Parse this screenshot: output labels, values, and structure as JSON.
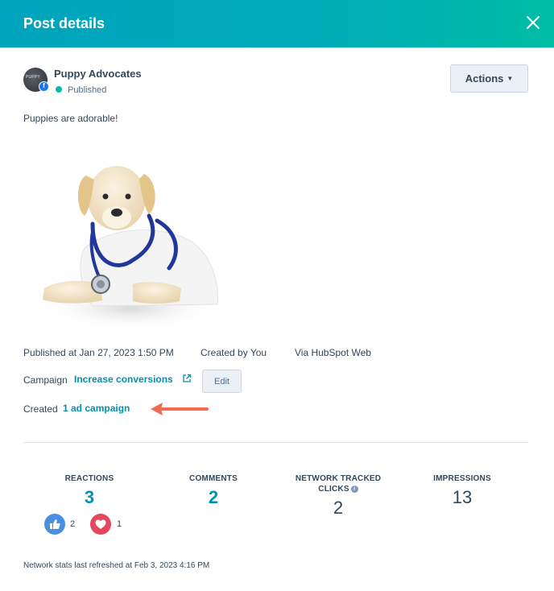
{
  "header": {
    "title": "Post details",
    "close_icon": "close-icon"
  },
  "account": {
    "name": "Puppy Advocates",
    "status": "Published",
    "status_color": "#00bda5",
    "avatar_text": "PUPPY",
    "network_badge": "f"
  },
  "actions": {
    "label": "Actions"
  },
  "post": {
    "text": "Puppies are adorable!",
    "image": "puppy-with-stethoscope"
  },
  "meta": {
    "published": "Published at Jan 27, 2023 1:50 PM",
    "created_by": "Created by You",
    "via": "Via HubSpot Web"
  },
  "campaign": {
    "label": "Campaign",
    "name": "Increase conversions",
    "edit_label": "Edit"
  },
  "created": {
    "label": "Created",
    "link": "1 ad campaign"
  },
  "stats": {
    "reactions": {
      "label": "REACTIONS",
      "value": "3"
    },
    "comments": {
      "label": "COMMENTS",
      "value": "2"
    },
    "clicks": {
      "label_line1": "NETWORK TRACKED",
      "label_line2": "CLICKS",
      "value": "2"
    },
    "impressions": {
      "label": "IMPRESSIONS",
      "value": "13"
    },
    "likes": {
      "count": "2",
      "icon": "thumbs-up-icon"
    },
    "loves": {
      "count": "1",
      "icon": "heart-icon"
    }
  },
  "footer": {
    "note": "Network stats last refreshed at Feb 3, 2023 4:16 PM"
  },
  "colors": {
    "header_start": "#00a4bd",
    "header_end": "#00bda5",
    "link": "#0091ae",
    "annotation_arrow": "#f26b4f"
  }
}
